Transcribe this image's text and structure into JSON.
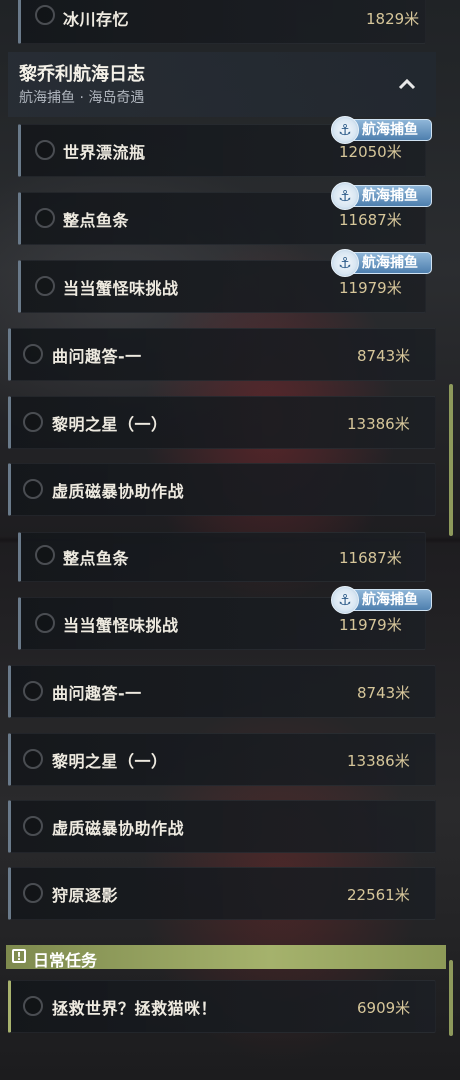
{
  "top_item": {
    "title": "冰川存忆",
    "distance": "1829米"
  },
  "group": {
    "title": "黎乔利航海日志",
    "subtitle": "航海捕鱼 · 海岛奇遇"
  },
  "badge_label": "航海捕鱼",
  "section1": {
    "sub_items": [
      {
        "title": "世界漂流瓶",
        "distance": "12050米",
        "badge": true
      },
      {
        "title": "整点鱼条",
        "distance": "11687米",
        "badge": true
      },
      {
        "title": "当当蟹怪味挑战",
        "distance": "11979米",
        "badge": true
      }
    ],
    "items": [
      {
        "title": "曲问趣答-一",
        "distance": "8743米"
      },
      {
        "title": "黎明之星（一）",
        "distance": "13386米"
      },
      {
        "title": "虚质磁暴协助作战",
        "distance": ""
      }
    ]
  },
  "section2": {
    "sub_items": [
      {
        "title": "整点鱼条",
        "distance": "11687米"
      },
      {
        "title": "当当蟹怪味挑战",
        "distance": "11979米",
        "badge": true
      }
    ],
    "items": [
      {
        "title": "曲问趣答-一",
        "distance": "8743米"
      },
      {
        "title": "黎明之星（一）",
        "distance": "13386米"
      },
      {
        "title": "虚质磁暴协助作战",
        "distance": ""
      },
      {
        "title": "狩原逐影",
        "distance": "22561米"
      }
    ]
  },
  "daily": {
    "header": "日常任务",
    "items": [
      {
        "title": "拯救世界？拯救猫咪！",
        "distance": "6909米"
      }
    ]
  },
  "icons": {
    "collapse": "chevron-up-icon",
    "badge": "anchor-icon",
    "daily": "warning-icon"
  }
}
